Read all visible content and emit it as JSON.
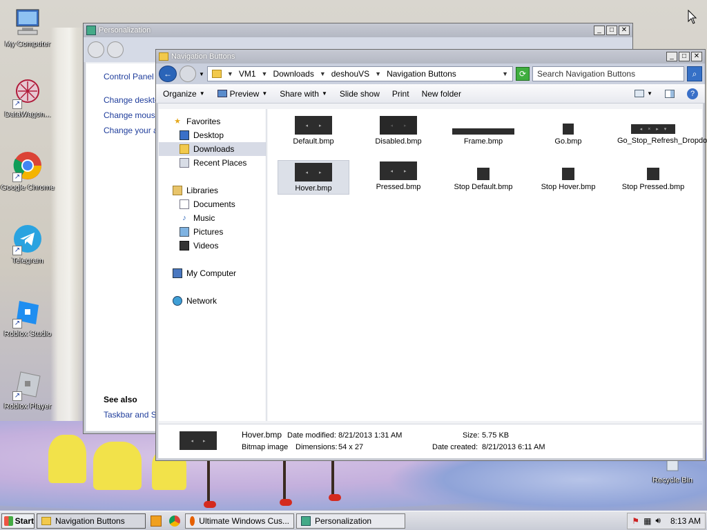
{
  "desktop": {
    "icons": [
      {
        "label": "My Computer"
      },
      {
        "label": "DataWagon..."
      },
      {
        "label": "Google Chrome"
      },
      {
        "label": "Telegram"
      },
      {
        "label": "Roblox Studio"
      },
      {
        "label": "Roblox Player"
      },
      {
        "label": "Recycle Bin"
      }
    ]
  },
  "personalization": {
    "title": "Personalization",
    "links": [
      "Control Panel H",
      "Change desktop",
      "Change mouse",
      "Change your ac"
    ],
    "see_also_heading": "See also",
    "see_also_links": [
      "Taskbar and Sta"
    ]
  },
  "explorer": {
    "title": "Navigation Buttons",
    "breadcrumb": [
      "VM1",
      "Downloads",
      "deshouVS",
      "Navigation Buttons"
    ],
    "search_placeholder": "Search Navigation Buttons",
    "toolbar": {
      "organize": "Organize",
      "preview": "Preview",
      "share_with": "Share with",
      "slide_show": "Slide show",
      "print": "Print",
      "new_folder": "New folder"
    },
    "nav_pane": {
      "favorites": "Favorites",
      "desktop": "Desktop",
      "downloads": "Downloads",
      "recent_places": "Recent Places",
      "libraries": "Libraries",
      "documents": "Documents",
      "music": "Music",
      "pictures": "Pictures",
      "videos": "Videos",
      "my_computer": "My Computer",
      "network": "Network"
    },
    "files": [
      {
        "name": "Default.bmp"
      },
      {
        "name": "Disabled.bmp"
      },
      {
        "name": "Frame.bmp"
      },
      {
        "name": "Go.bmp"
      },
      {
        "name": "Go_Stop_Refresh_Dropdown.bmp"
      },
      {
        "name": "Hover.bmp"
      },
      {
        "name": "Pressed.bmp"
      },
      {
        "name": "Stop Default.bmp"
      },
      {
        "name": "Stop Hover.bmp"
      },
      {
        "name": "Stop Pressed.bmp"
      }
    ],
    "details": {
      "name": "Hover.bmp",
      "type": "Bitmap image",
      "modified_label": "Date modified:",
      "modified_value": "8/21/2013 1:31 AM",
      "dimensions_label": "Dimensions:",
      "dimensions_value": "54 x 27",
      "size_label": "Size:",
      "size_value": "5.75 KB",
      "created_label": "Date created:",
      "created_value": "8/21/2013 6:11 AM"
    }
  },
  "taskbar": {
    "start": "Start",
    "tasks": [
      "Navigation Buttons",
      "Ultimate Windows Cus...",
      "Personalization"
    ],
    "clock": "8:13 AM"
  }
}
